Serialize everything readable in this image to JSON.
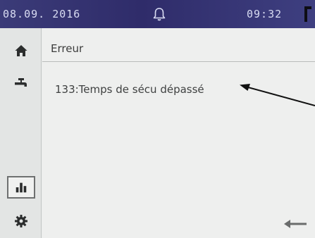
{
  "status_bar": {
    "date": "08.09. 2016",
    "time": "09:32",
    "bell_icon": "bell-icon"
  },
  "sidebar": {
    "items": [
      {
        "name": "home",
        "icon": "home-icon"
      },
      {
        "name": "tap",
        "icon": "faucet-icon"
      },
      {
        "name": "stats",
        "icon": "bar-chart-icon",
        "selected": true
      },
      {
        "name": "settings",
        "icon": "gear-icon"
      }
    ]
  },
  "main": {
    "title": "Erreur",
    "error_message": "133:Temps de sécu dépassé",
    "back_icon": "back-arrow-icon"
  },
  "colors": {
    "status_bar_bg": "#2f2c6a",
    "status_text": "#d9dcf2",
    "screen_bg": "#eeefee",
    "icon_color": "#2b2d2d"
  }
}
